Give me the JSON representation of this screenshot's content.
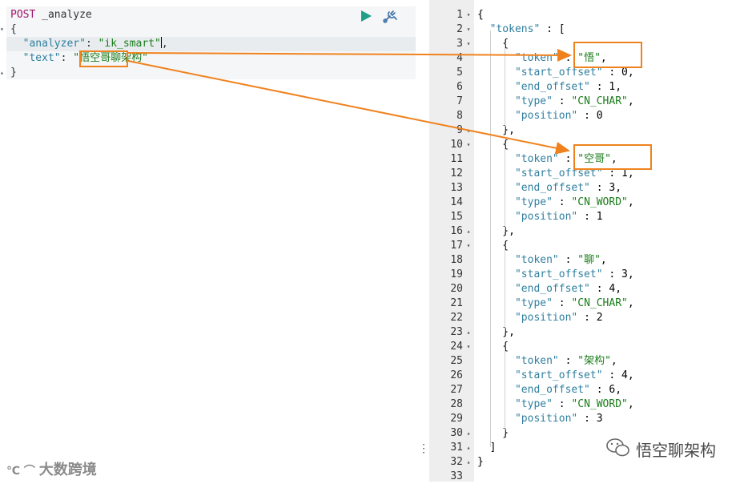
{
  "request": {
    "method": "POST",
    "endpoint": " _analyze",
    "lines": [
      "{",
      "  \"analyzer\": \"ik_smart\",",
      "  \"text\": \"悟空哥聊架构\"",
      "}"
    ],
    "analyzer_key": "\"analyzer\"",
    "analyzer_value": "\"ik_smart\"",
    "text_key": "\"text\"",
    "text_value": "\"悟空哥聊架构\""
  },
  "toolbar": {
    "run_icon": "play-icon",
    "settings_icon": "wrench-icon"
  },
  "response": {
    "line_numbers": [
      "1",
      "2",
      "3",
      "4",
      "5",
      "6",
      "7",
      "8",
      "9",
      "10",
      "11",
      "12",
      "13",
      "14",
      "15",
      "16",
      "17",
      "18",
      "19",
      "20",
      "21",
      "22",
      "23",
      "24",
      "25",
      "26",
      "27",
      "28",
      "29",
      "30",
      "31",
      "32",
      "33"
    ],
    "lines": [
      "{",
      "  \"tokens\" : [",
      "    {",
      "      \"token\" : \"悟\",",
      "      \"start_offset\" : 0,",
      "      \"end_offset\" : 1,",
      "      \"type\" : \"CN_CHAR\",",
      "      \"position\" : 0",
      "    },",
      "    {",
      "      \"token\" : \"空哥\",",
      "      \"start_offset\" : 1,",
      "      \"end_offset\" : 3,",
      "      \"type\" : \"CN_WORD\",",
      "      \"position\" : 1",
      "    },",
      "    {",
      "      \"token\" : \"聊\",",
      "      \"start_offset\" : 3,",
      "      \"end_offset\" : 4,",
      "      \"type\" : \"CN_CHAR\",",
      "      \"position\" : 2",
      "    },",
      "    {",
      "      \"token\" : \"架构\",",
      "      \"start_offset\" : 4,",
      "      \"end_offset\" : 6,",
      "      \"type\" : \"CN_WORD\",",
      "      \"position\" : 3",
      "    }",
      "  ]",
      "}",
      ""
    ]
  },
  "watermarks": {
    "left": "大数跨境",
    "right": "悟空聊架构"
  },
  "colors": {
    "annotation": "#f0821e",
    "method": "#a0146e",
    "key": "#2f7f9f",
    "string": "#1a7d1a",
    "run_button": "#1f9e89"
  }
}
